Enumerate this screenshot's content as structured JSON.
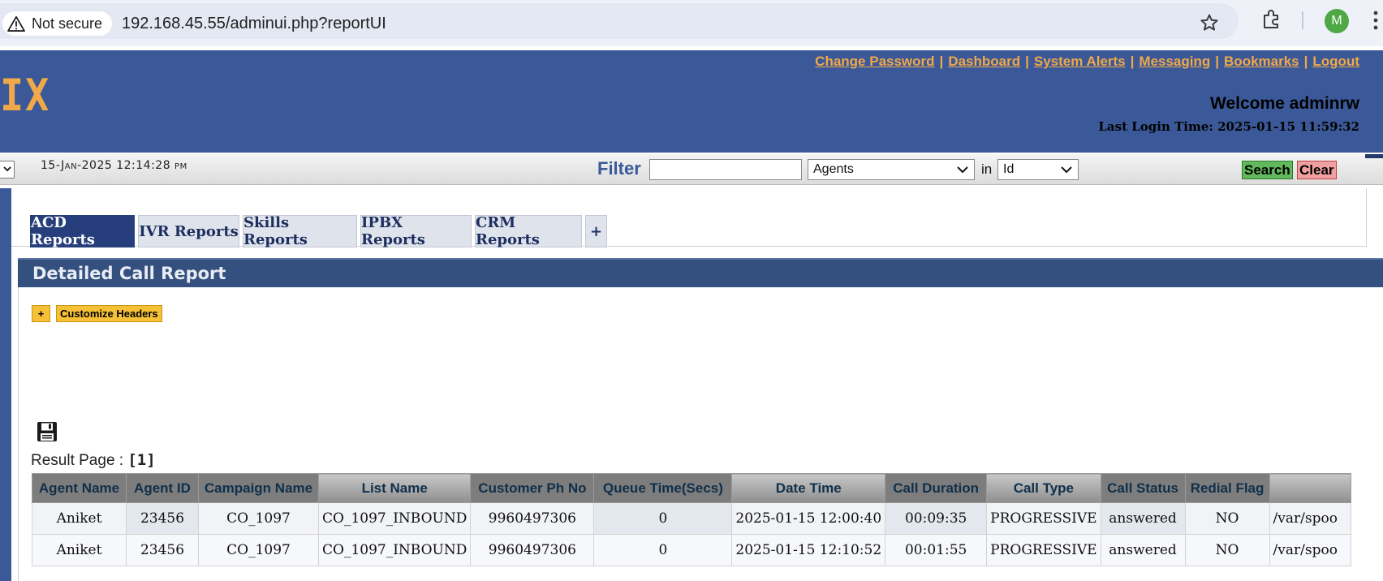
{
  "browser": {
    "security_label": "Not secure",
    "url": "192.168.45.55/adminui.php?reportUI",
    "profile_initial": "M"
  },
  "header": {
    "logo_text": "IX",
    "links": [
      "Change Password",
      "Dashboard",
      "System Alerts",
      "Messaging",
      "Bookmarks",
      "Logout"
    ],
    "separator": "|",
    "welcome": "Welcome adminrw",
    "last_login": "Last Login Time: 2025-01-15 11:59:32"
  },
  "filter_bar": {
    "datetime": "15-Jan-2025 12:14:28 pm",
    "filter_label": "Filter",
    "filter_value": "",
    "type_select": "Agents",
    "in_label": "in",
    "field_select": "Id",
    "search_label": "Search",
    "clear_label": "Clear"
  },
  "tabs": [
    {
      "label": "ACD Reports",
      "active": true
    },
    {
      "label": "IVR Reports",
      "active": false
    },
    {
      "label": "Skills Reports",
      "active": false
    },
    {
      "label": "IPBX Reports",
      "active": false
    },
    {
      "label": "CRM Reports",
      "active": false
    },
    {
      "label": "+",
      "active": false
    }
  ],
  "report": {
    "title": "Detailed Call Report",
    "expand_label": "+",
    "customize_label": "Customize Headers",
    "result_page_label": "Result Page : ",
    "result_page_value": "[1]"
  },
  "table": {
    "columns": [
      "Agent Name",
      "Agent ID",
      "Campaign Name",
      "List Name",
      "Customer Ph No",
      "Queue Time(Secs)",
      "Date Time",
      "Call Duration",
      "Call Type",
      "Call Status",
      "Redial Flag",
      ""
    ],
    "rows": [
      [
        "Aniket",
        "23456",
        "CO_1097",
        "CO_1097_INBOUND",
        "9960497306",
        "0",
        "2025-01-15 12:00:40",
        "00:09:35",
        "PROGRESSIVE",
        "answered",
        "NO",
        "/var/spoo"
      ],
      [
        "Aniket",
        "23456",
        "CO_1097",
        "CO_1097_INBOUND",
        "9960497306",
        "0",
        "2025-01-15 12:10:52",
        "00:01:55",
        "PROGRESSIVE",
        "answered",
        "NO",
        "/var/spoo"
      ]
    ]
  },
  "colors": {
    "header_blue": "#3b5998",
    "link_orange": "#f0a848",
    "active_tab": "#263f7c",
    "report_head": "#34507f"
  }
}
